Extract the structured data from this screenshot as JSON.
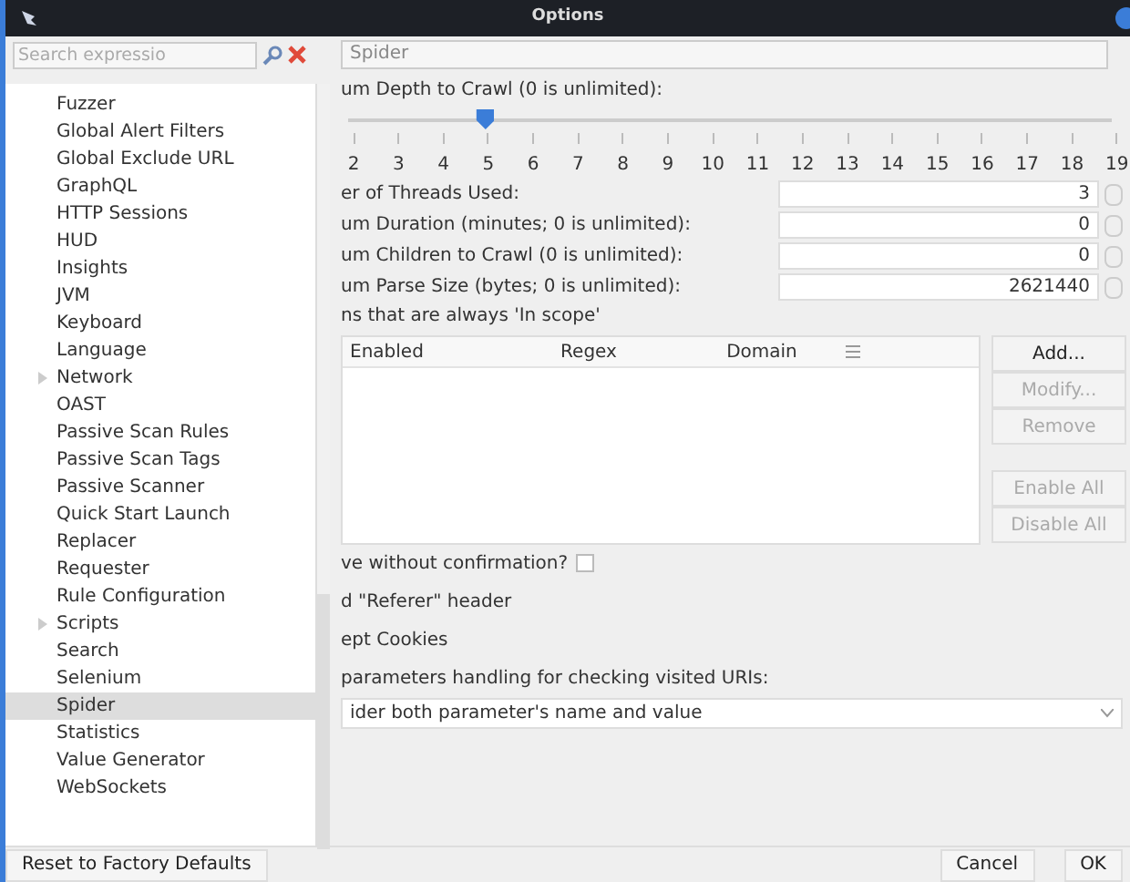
{
  "window": {
    "title": "Options"
  },
  "sidebar": {
    "search": {
      "placeholder": "Search expressio"
    },
    "items": [
      {
        "label": "Fuzzer",
        "selected": false,
        "expandable": false
      },
      {
        "label": "Global Alert Filters",
        "selected": false,
        "expandable": false
      },
      {
        "label": "Global Exclude URL",
        "selected": false,
        "expandable": false
      },
      {
        "label": "GraphQL",
        "selected": false,
        "expandable": false
      },
      {
        "label": "HTTP Sessions",
        "selected": false,
        "expandable": false
      },
      {
        "label": "HUD",
        "selected": false,
        "expandable": false
      },
      {
        "label": "Insights",
        "selected": false,
        "expandable": false
      },
      {
        "label": "JVM",
        "selected": false,
        "expandable": false
      },
      {
        "label": "Keyboard",
        "selected": false,
        "expandable": false
      },
      {
        "label": "Language",
        "selected": false,
        "expandable": false
      },
      {
        "label": "Network",
        "selected": false,
        "expandable": true
      },
      {
        "label": "OAST",
        "selected": false,
        "expandable": false
      },
      {
        "label": "Passive Scan Rules",
        "selected": false,
        "expandable": false
      },
      {
        "label": "Passive Scan Tags",
        "selected": false,
        "expandable": false
      },
      {
        "label": "Passive Scanner",
        "selected": false,
        "expandable": false
      },
      {
        "label": "Quick Start Launch",
        "selected": false,
        "expandable": false
      },
      {
        "label": "Replacer",
        "selected": false,
        "expandable": false
      },
      {
        "label": "Requester",
        "selected": false,
        "expandable": false
      },
      {
        "label": "Rule Configuration",
        "selected": false,
        "expandable": false
      },
      {
        "label": "Scripts",
        "selected": false,
        "expandable": true
      },
      {
        "label": "Search",
        "selected": false,
        "expandable": false
      },
      {
        "label": "Selenium",
        "selected": false,
        "expandable": false
      },
      {
        "label": "Spider",
        "selected": true,
        "expandable": false
      },
      {
        "label": "Statistics",
        "selected": false,
        "expandable": false
      },
      {
        "label": "Value Generator",
        "selected": false,
        "expandable": false
      },
      {
        "label": "WebSockets",
        "selected": false,
        "expandable": false
      }
    ]
  },
  "panel": {
    "title": "Spider",
    "depth": {
      "label": "um Depth to Crawl (0 is unlimited):",
      "level": 0.18,
      "ticks": [
        "2",
        "3",
        "4",
        "5",
        "6",
        "7",
        "8",
        "9",
        "10",
        "11",
        "12",
        "13",
        "14",
        "15",
        "16",
        "17",
        "18",
        "19"
      ]
    },
    "fields": [
      {
        "label": "er of Threads Used:",
        "value": "3"
      },
      {
        "label": "um Duration (minutes; 0 is unlimited):",
        "value": "0"
      },
      {
        "label": "um Children to Crawl (0 is unlimited):",
        "value": "0"
      },
      {
        "label": "um Parse Size (bytes; 0 is unlimited):",
        "value": "2621440"
      }
    ],
    "scope": {
      "label": "ns that are always 'In scope'",
      "columns": [
        "Enabled",
        "Regex",
        "Domain"
      ],
      "buttons": [
        {
          "label": "Add...",
          "disabled": false
        },
        {
          "label": "Modify...",
          "disabled": true
        },
        {
          "label": "Remove",
          "disabled": true
        },
        {
          "label": "Enable All",
          "disabled": true,
          "gap": true
        },
        {
          "label": "Disable All",
          "disabled": true
        }
      ]
    },
    "confirm": {
      "label": "ve without confirmation?",
      "checked": false
    },
    "options": [
      "d \"Referer\" header",
      "ept Cookies"
    ],
    "params": {
      "label": " parameters handling for checking visited URIs:",
      "value": "ider both parameter's name and value"
    }
  },
  "footer": {
    "reset": "Reset to Factory Defaults",
    "buttons": [
      "Cancel",
      "OK"
    ]
  }
}
